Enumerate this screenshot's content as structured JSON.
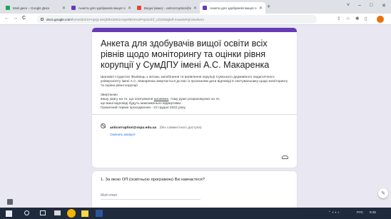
{
  "browser": {
    "tabs": [
      {
        "title": "Мой диск – Google Диск",
        "active": false,
        "favicon_color": "#1fa463"
      },
      {
        "title": "Анкета для здобувачів вищої о",
        "active": false,
        "favicon_color": "#673ab7"
      },
      {
        "title": "Вхідні (маю) – anticorruption@sspu.edu.ua",
        "active": false,
        "favicon_color": "#ea4335"
      },
      {
        "title": "Анкета для здобувачів вищої о",
        "active": true,
        "favicon_color": "#673ab7"
      }
    ],
    "new_tab": "+",
    "window_controls": {
      "minimize": "–",
      "maximize": "□",
      "close": "✕",
      "menu": "˅"
    },
    "nav": {
      "back": "←",
      "forward": "→",
      "reload": "C",
      "home": "⌂"
    },
    "url_host": "docs.google.com",
    "url_path": "/forms/d/e/1FAIpQLSeQEtbUbW1ASpDfbOH1sPVjaGdCf_cZZd39gkdf-mwa0vRQ/viewform"
  },
  "form": {
    "title": "Анкета для здобувачів вищої освіти всіх рівнів щодо моніторингу та оцінки рівня корупції  у СумДПУ імені А.С. Макаренка",
    "description": {
      "p1": "Шановні студенти! Фахівець з питань запобігання та виявлення корупції Сумського державного педагогічного",
      "p2": "університету імені А.С. Макаренка звертається до вас із проханням дати відповіді в опитувальнику щодо моніторингу та оцінки рівня корупції.",
      "p3": "Звертаємо",
      "p4_a": "вашу увагу на те, що опитування ",
      "p4_anon": "анонімне",
      "p4_b": ", тому дуже розраховуємо на те,",
      "p5": "що ваші відповіді будуть максимально відвертими.",
      "p6": "Граничний термін проходження - 23 грудня 2022 року."
    },
    "account": {
      "email": "anticorruption@sspu.edu.ua",
      "note": "(без совместного доступа)",
      "switch_label": "Сменить аккаунт"
    },
    "question": {
      "text": "1. За якою ОП (освітньою програмою) Ви навчаєтеся?",
      "placeholder": "Мой ответ"
    }
  },
  "taskbar": {
    "lang": "РУС",
    "time": "9:25",
    "icons": [
      "windows-icon",
      "search-icon",
      "task-view-icon",
      "file-explorer-icon",
      "chrome-icon",
      "files-icon",
      "word-icon"
    ]
  },
  "colors": {
    "accent": "#673ab7",
    "page_bg": "#e9e7f1",
    "link": "#1a73e8"
  }
}
